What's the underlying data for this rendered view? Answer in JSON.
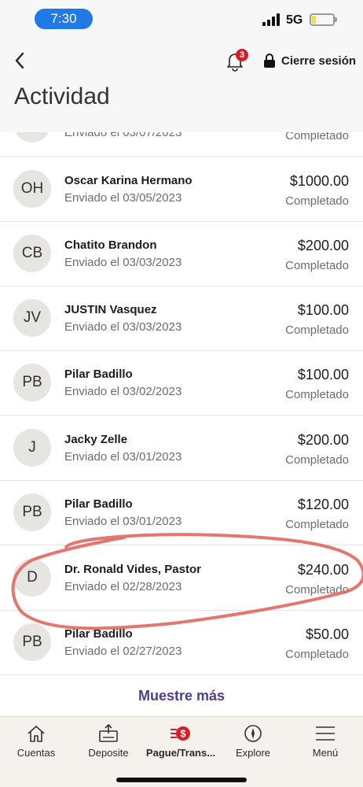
{
  "status_bar": {
    "time": "7:30",
    "network": "5G",
    "battery_level": 0.2
  },
  "header": {
    "back_icon": "chevron-left-icon",
    "notifications_count": "3",
    "logout_label": "Cierre sesión",
    "title": "Actividad"
  },
  "transactions": [
    {
      "initials": "",
      "name": "",
      "date": "Enviado el 03/07/2023",
      "amount": "",
      "status": "Completado"
    },
    {
      "initials": "OH",
      "name": "Oscar Karina Hermano",
      "date": "Enviado el 03/05/2023",
      "amount": "$1000.00",
      "status": "Completado"
    },
    {
      "initials": "CB",
      "name": "Chatito Brandon",
      "date": "Enviado el 03/03/2023",
      "amount": "$200.00",
      "status": "Completado"
    },
    {
      "initials": "JV",
      "name": "JUSTIN Vasquez",
      "date": "Enviado el 03/03/2023",
      "amount": "$100.00",
      "status": "Completado"
    },
    {
      "initials": "PB",
      "name": "Pilar Badillo",
      "date": "Enviado el 03/02/2023",
      "amount": "$100.00",
      "status": "Completado"
    },
    {
      "initials": "J",
      "name": "Jacky Zelle",
      "date": "Enviado el 03/01/2023",
      "amount": "$200.00",
      "status": "Completado"
    },
    {
      "initials": "PB",
      "name": "Pilar Badillo",
      "date": "Enviado el 03/01/2023",
      "amount": "$120.00",
      "status": "Completado"
    },
    {
      "initials": "D",
      "name": "Dr. Ronald Vides, Pastor",
      "date": "Enviado el 02/28/2023",
      "amount": "$240.00",
      "status": "Completado"
    },
    {
      "initials": "PB",
      "name": "Pilar Badillo",
      "date": "Enviado el 02/27/2023",
      "amount": "$50.00",
      "status": "Completado"
    }
  ],
  "more_label": "Muestre más",
  "tabs": [
    {
      "label": "Cuentas",
      "icon": "home-icon"
    },
    {
      "label": "Deposite",
      "icon": "deposit-icon"
    },
    {
      "label": "Pague/Trans...",
      "icon": "pay-transfer-icon",
      "active": true
    },
    {
      "label": "Explore",
      "icon": "compass-icon"
    },
    {
      "label": "Menú",
      "icon": "menu-icon"
    }
  ],
  "colors": {
    "accent": "#4e3f8a",
    "brand_red": "#d71e28",
    "time_pill": "#1f7ae8",
    "annotation_stroke": "#e0675f"
  }
}
